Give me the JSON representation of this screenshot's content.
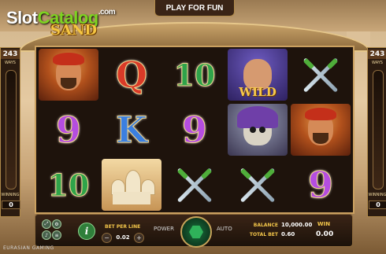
{
  "site_watermark": {
    "part1": "Slot",
    "part2": "Catalog",
    "part3": ".com"
  },
  "game_logo": "SAND",
  "mode_button": "PLAY FOR FUN",
  "ways": {
    "value": "243",
    "label": "WAYS"
  },
  "winning": {
    "label": "WINNING",
    "left_value": "0",
    "right_value": "0"
  },
  "reels": [
    [
      {
        "type": "portrait",
        "name": "arab-man-symbol"
      },
      {
        "type": "letter",
        "text": "9",
        "color": "9"
      },
      {
        "type": "letter",
        "text": "10",
        "color": "10"
      }
    ],
    [
      {
        "type": "letter",
        "text": "Q",
        "color": "Q"
      },
      {
        "type": "letter",
        "text": "K",
        "color": "K"
      },
      {
        "type": "palace",
        "name": "palace-symbol"
      }
    ],
    [
      {
        "type": "letter",
        "text": "10",
        "color": "10"
      },
      {
        "type": "letter",
        "text": "9",
        "color": "9"
      },
      {
        "type": "swords",
        "name": "crossed-swords-symbol"
      }
    ],
    [
      {
        "type": "wild",
        "name": "wild-princess-symbol",
        "label": "WILD"
      },
      {
        "type": "skull",
        "name": "skull-symbol"
      },
      {
        "type": "swords",
        "name": "crossed-swords-symbol"
      }
    ],
    [
      {
        "type": "swords",
        "name": "crossed-swords-symbol"
      },
      {
        "type": "portrait",
        "name": "arab-man-symbol"
      },
      {
        "type": "letter",
        "text": "9",
        "color": "9"
      }
    ]
  ],
  "controls": {
    "info_label": "i",
    "bet_per_line_label": "BET PER LINE",
    "bet_per_line_value": "0.02",
    "minus": "−",
    "plus": "+",
    "power_label": "POWER",
    "auto_label": "AUTO",
    "balance_label": "BALANCE",
    "balance_value": "10,000.00",
    "total_bet_label": "TOTAL BET",
    "total_bet_value": "0.60",
    "win_label": "WIN",
    "win_value": "0.00"
  },
  "provider": "EURASIAN GAMING",
  "colors": {
    "letter_9": "#b44de0",
    "letter_10": "#2fa34a",
    "letter_Q": "#d93a28",
    "letter_K": "#3b7fe0",
    "gold": "#f3c64a"
  }
}
